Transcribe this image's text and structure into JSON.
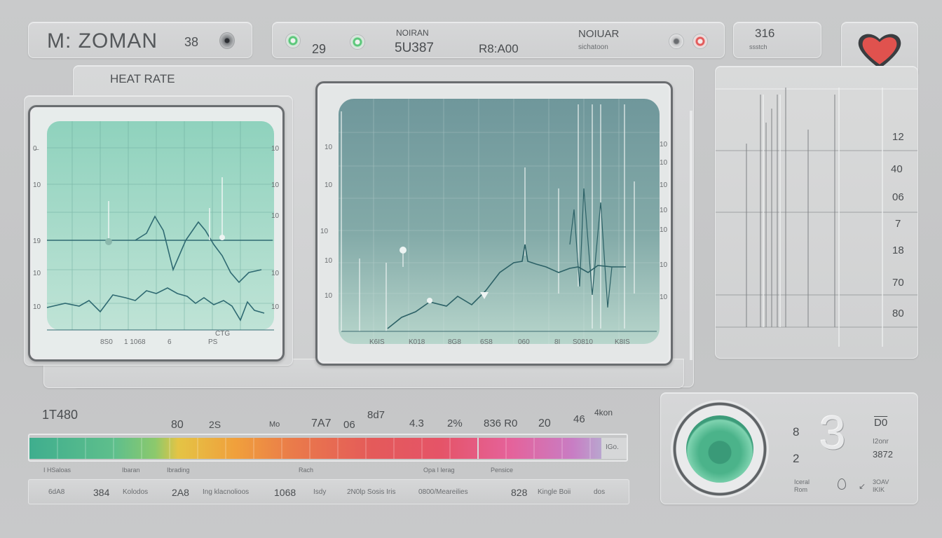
{
  "header": {
    "brand_title": "M:  ZOMAN",
    "brand_value": "38",
    "stat_a": "29",
    "stat_b_label": "NOIRAN",
    "stat_b_value": "5U387",
    "stat_c": "R8:A00",
    "stat_d_label": "NOIUAR",
    "stat_d_sub": "sichatoon",
    "box_value": "316",
    "box_sub": "ssstch"
  },
  "panel_title": "HEAT RATE",
  "screen1": {
    "y_ticks": [
      "0̶",
      "10",
      "19",
      "10",
      "10"
    ],
    "y_ticks_right": [
      "10",
      "10",
      "10",
      "10",
      "10"
    ],
    "x_ticks": [
      "8S0",
      "1 1068",
      "6",
      "PS",
      "CTG"
    ]
  },
  "screen2": {
    "y_ticks": [
      "10",
      "10",
      "10",
      "10",
      "10"
    ],
    "y_ticks_right": [
      "10",
      "10",
      "10",
      "10",
      "10",
      "10",
      "10"
    ],
    "x_ticks": [
      "K6IS",
      "K018",
      "8G8",
      "6S8",
      "060",
      "8I",
      "S0810",
      "K8IS"
    ]
  },
  "right_chart": {
    "labels": [
      "12",
      "40",
      "06",
      "7",
      "18",
      "70",
      "80"
    ]
  },
  "scale": {
    "left_label": "1T480",
    "labels_top": [
      "80",
      "2S",
      "Mo",
      "7A7",
      "06",
      "8d7",
      "4.3",
      "2%",
      "836 R0",
      "20",
      "46",
      "4kon"
    ],
    "labels_bottom": [
      "I HSaloas",
      "Ibaran",
      "Ibrading",
      "Rach",
      "Opa I lerag",
      "Pensice"
    ],
    "tail_label": "IGo."
  },
  "info_strip": [
    "6dA8",
    "384",
    "Kolodos",
    "2A8",
    "Ing klacnolioos",
    "1068",
    "Isdy",
    "2N0lp Sosis Iris",
    "0800/Meareilies",
    "828",
    "Kingle Boii",
    "dos"
  ],
  "dial_panel": {
    "big_number": "3",
    "left_top": "8",
    "left_bottom": "2",
    "right_top": "D0",
    "right_mid1": "I2onr",
    "right_mid2": "3872",
    "footer_left": "Iceral\nRom",
    "footer_right": "3OAV\nIKIK"
  },
  "colors": {
    "accent_green": "#4bb38a",
    "alert_red": "#e25b5b",
    "trace": "#2f6a72",
    "background": "#c7c8c9"
  }
}
